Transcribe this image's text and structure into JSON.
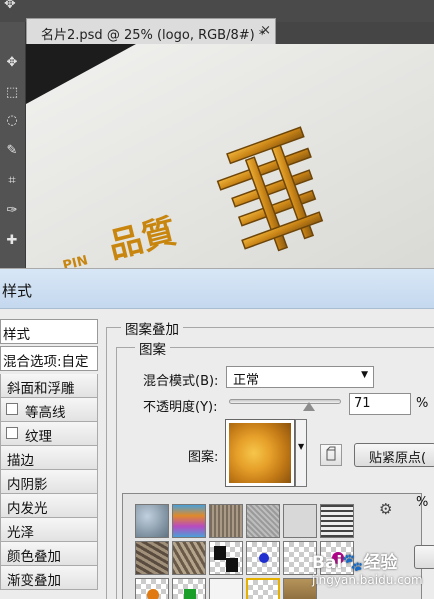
{
  "document": {
    "tab_title": "名片2.psd @ 25% (logo, RGB/8#) *",
    "close_glyph": "×"
  },
  "toolbar": {
    "tools": [
      "move-icon",
      "marquee-icon",
      "lasso-icon",
      "quick-select-icon",
      "crop-icon",
      "eyedropper-icon",
      "healing-icon"
    ]
  },
  "canvas": {
    "logo_text": "PIN",
    "brand_chars": "品質",
    "colors": {
      "gold": "#d8941e",
      "paper": "#e9e9e6"
    }
  },
  "dialog": {
    "title": "样式",
    "left_panel": {
      "header": "样式",
      "blend_options": "混合选项:自定",
      "items": [
        {
          "label": "斜面和浮雕",
          "checkbox": false
        },
        {
          "label": "等高线",
          "checkbox": true
        },
        {
          "label": "纹理",
          "checkbox": true
        },
        {
          "label": "描边",
          "checkbox": false
        },
        {
          "label": "内阴影",
          "checkbox": false
        },
        {
          "label": "内发光",
          "checkbox": false
        },
        {
          "label": "光泽",
          "checkbox": false
        },
        {
          "label": "颜色叠加",
          "checkbox": false
        },
        {
          "label": "渐变叠加",
          "checkbox": false
        }
      ]
    },
    "section_title": "图案叠加",
    "group_title": "图案",
    "blend_mode_label": "混合模式(B):",
    "blend_mode_value": "正常",
    "opacity_label": "不透明度(Y):",
    "opacity_value": "71",
    "opacity_percent": 71,
    "opacity_unit": "%",
    "pattern_label": "图案:",
    "snap_button": "贴紧原点(",
    "scale_unit": "%"
  },
  "watermark": {
    "brand": "Bai",
    "brand2": "经验",
    "url": "jingyan.baidu.com"
  }
}
